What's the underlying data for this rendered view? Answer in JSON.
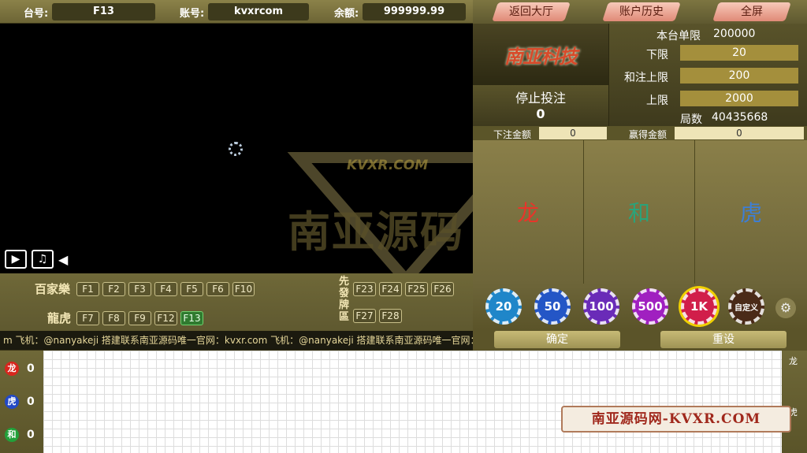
{
  "topbar": {
    "table_label": "台号:",
    "table_value": "F13",
    "account_label": "账号:",
    "account_value": "kvxrcom",
    "balance_label": "余额:",
    "balance_value": "999999.99"
  },
  "nav": {
    "back_lobby": "返回大厅",
    "history": "账户历史",
    "fullscreen": "全屏"
  },
  "watermark": {
    "url": "KVXR.COM",
    "text": "南亚源码"
  },
  "media": {
    "video_icon": "video-camera-icon",
    "music_icon": "music-note-icon",
    "collapse_icon": "triangle-left-icon"
  },
  "tables": {
    "baccarat_label": "百家樂",
    "baccarat": [
      "F1",
      "F2",
      "F3",
      "F4",
      "F5",
      "F6",
      "F10"
    ],
    "dragon_tiger_label": "龍虎",
    "dragon_tiger": [
      "F7",
      "F8",
      "F9",
      "F12",
      "F13"
    ],
    "active": "F13",
    "deal_first_label": "先發牌區",
    "deal_first_row1": [
      "F23",
      "F24",
      "F25",
      "F26"
    ],
    "deal_first_row2": [
      "F27",
      "F28"
    ]
  },
  "ticker": "m 飞机：@nanyakeji 搭建联系南亚源码唯一官网：kvxr.com 飞机：@nanyakeji 搭建联系南亚源码唯一官网：kvx",
  "logo": "南亚科技",
  "status": {
    "text": "停止投注",
    "count": "0"
  },
  "limits": {
    "table_limit_label": "本台单限",
    "table_limit_value": "200000",
    "min_label": "下限",
    "min_value": "20",
    "tie_max_label": "和注上限",
    "tie_max_value": "200",
    "max_label": "上限",
    "max_value": "2000",
    "rounds_label": "局数",
    "rounds_value": "40435668"
  },
  "amounts": {
    "bet_label": "下注金额",
    "bet_value": "0",
    "win_label": "赢得金额",
    "win_value": "0"
  },
  "zones": {
    "dragon": "龙",
    "tie": "和",
    "tiger": "虎",
    "dragon_color": "#e8352a",
    "tie_color": "#2aa37a",
    "tiger_color": "#3d7fd6"
  },
  "chips": [
    {
      "label": "20",
      "color": "#1f86c9"
    },
    {
      "label": "50",
      "color": "#2456c6"
    },
    {
      "label": "100",
      "color": "#6a2bb8"
    },
    {
      "label": "500",
      "color": "#a020c0"
    },
    {
      "label": "1K",
      "color": "#d11e4a"
    },
    {
      "label": "自定义",
      "color": "#4a2a18"
    }
  ],
  "actions": {
    "confirm": "确定",
    "reset": "重设"
  },
  "road": {
    "dragon_label": "龙",
    "dragon_count": "0",
    "tiger_label": "虎",
    "tiger_count": "0",
    "tie_label": "和",
    "tie_count": "0",
    "right_dragon": "龙",
    "right_tiger": "虎"
  },
  "banner": "南亚源码网-KVXR.COM"
}
